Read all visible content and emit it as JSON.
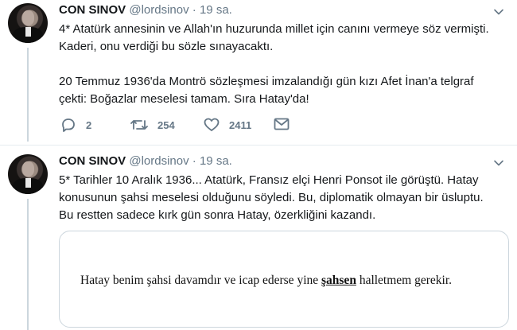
{
  "tweets": [
    {
      "name": "CON SINOV",
      "handle": "@lordsinov",
      "separator": "·",
      "time": "19 sa.",
      "text_line1": "4* Atatürk annesinin ve Allah'ın huzurunda millet için canını vermeye söz vermişti.",
      "text_line2": "Kaderi, onu verdiği bu sözle sınayacaktı.",
      "text_line3": "20 Temmuz 1936'da Montrö sözleşmesi imzalandığı gün kızı Afet İnan'a telgraf",
      "text_line4": "çekti: Boğazlar meselesi tamam. Sıra Hatay'da!",
      "replies": "2",
      "retweets": "254",
      "likes": "2411"
    },
    {
      "name": "CON SINOV",
      "handle": "@lordsinov",
      "separator": "·",
      "time": "19 sa.",
      "text_line1": "5* Tarihler 10 Aralık 1936... Atatürk, Fransız elçi Henri Ponsot ile görüştü. Hatay",
      "text_line2": "konusunun şahsi meselesi olduğunu söyledi. Bu, diplomatik olmayan bir üsluptu.",
      "text_line3": "Bu restten sadece kırk gün sonra Hatay, özerkliğini kazandı.",
      "card": {
        "before": "Hatay benim şahsi davamdır ve icap ederse yine ",
        "underlined": "şahsen",
        "after": " halletmem gerekir."
      }
    }
  ],
  "icons": {
    "reply": "reply-icon",
    "retweet": "retweet-icon",
    "like": "heart-icon",
    "dm": "envelope-icon",
    "more": "chevron-down-icon"
  },
  "colors": {
    "name": "#14171a",
    "meta": "#657786",
    "line": "#ccd6dd"
  }
}
